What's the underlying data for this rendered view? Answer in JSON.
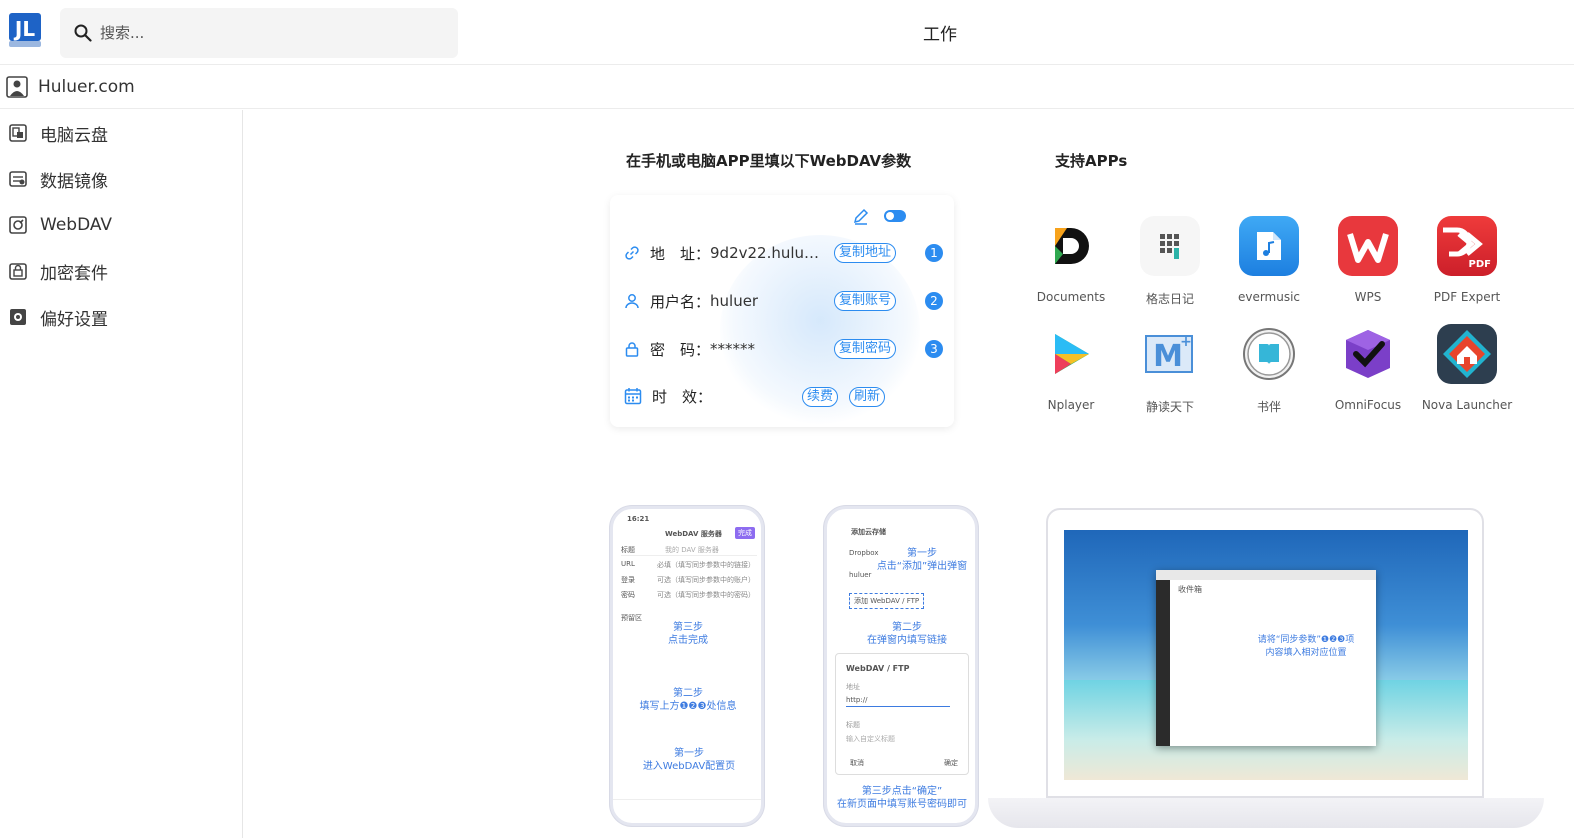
{
  "header": {
    "search_placeholder": "搜索...",
    "title": "工作"
  },
  "account": {
    "name": "Huluer.com"
  },
  "sidebar": {
    "items": [
      {
        "label": "电脑云盘",
        "icon": "cloud-drive-icon"
      },
      {
        "label": "数据镜像",
        "icon": "data-mirror-icon"
      },
      {
        "label": "WebDAV",
        "icon": "webdav-icon"
      },
      {
        "label": "加密套件",
        "icon": "encryption-icon"
      },
      {
        "label": "偏好设置",
        "icon": "settings-icon"
      }
    ]
  },
  "webdav": {
    "heading": "在手机或电脑APP里填以下WebDAV参数",
    "address_key": "地　址：",
    "address_value": "9d2v22.huluer...",
    "address_button": "复制地址",
    "username_key": "用户名：",
    "username_value": "huluer",
    "username_button": "复制账号",
    "password_key": "密　码：",
    "password_value": "******",
    "password_button": "复制密码",
    "validity_key": "时　效：",
    "renew_button": "续费",
    "refresh_button": "刷新",
    "step_numbers": [
      "1",
      "2",
      "3"
    ]
  },
  "apps": {
    "heading": "支持APPs",
    "list": [
      {
        "name": "Documents",
        "icon": "documents-app-icon"
      },
      {
        "name": "格志日记",
        "icon": "gezhi-diary-app-icon"
      },
      {
        "name": "evermusic",
        "icon": "evermusic-app-icon"
      },
      {
        "name": "WPS",
        "icon": "wps-app-icon"
      },
      {
        "name": "PDF Expert",
        "icon": "pdf-expert-app-icon"
      },
      {
        "name": "Nplayer",
        "icon": "nplayer-app-icon"
      },
      {
        "name": "静读天下",
        "icon": "moon-reader-app-icon"
      },
      {
        "name": "书伴",
        "icon": "shuban-app-icon"
      },
      {
        "name": "OmniFocus",
        "icon": "omnifocus-app-icon"
      },
      {
        "name": "Nova Launcher",
        "icon": "nova-launcher-app-icon"
      }
    ],
    "pdf_badge": "PDF"
  },
  "guide1": {
    "time": "16:21",
    "title": "WebDAV 服务器",
    "done": "完成",
    "f_title": "标题",
    "f_title_ph": "我的 DAV 服务器",
    "f_url": "URL",
    "f_login": "登录",
    "f_pwd": "密码",
    "f_url_ph": "必填（填写同步参数中的链接）",
    "f_login_ph": "可选（填写同步参数中的账户）",
    "f_pwd_ph": "可选（填写同步参数中的密码）",
    "f_preview": "预留区",
    "step3": "第三步\n点击完成",
    "step2": "第二步\n填写上方❶❷❸处信息",
    "step1": "第一步\n进入WebDAV配置页"
  },
  "guide2": {
    "title": "添加云存储",
    "dropbox": "Dropbox",
    "huluer": "huluer",
    "add": "添加 WebDAV / FTP",
    "dialog_title": "WebDAV / FTP",
    "addr_label": "地址",
    "addr_value": "http://",
    "name_label": "标题",
    "name_ph": "输入自定义标题",
    "cancel": "取消",
    "confirm": "确定",
    "step1": "第一步\n点击“添加”弹出弹窗",
    "step2": "第二步\n在弹窗内填写链接",
    "step3": "第三步点击“确定”\n在新页面中填写账号密码即可"
  },
  "guide3": {
    "window_title": "收件箱",
    "tip": "请将“同步参数”❶❷❸项\n内容填入相对应位置"
  }
}
